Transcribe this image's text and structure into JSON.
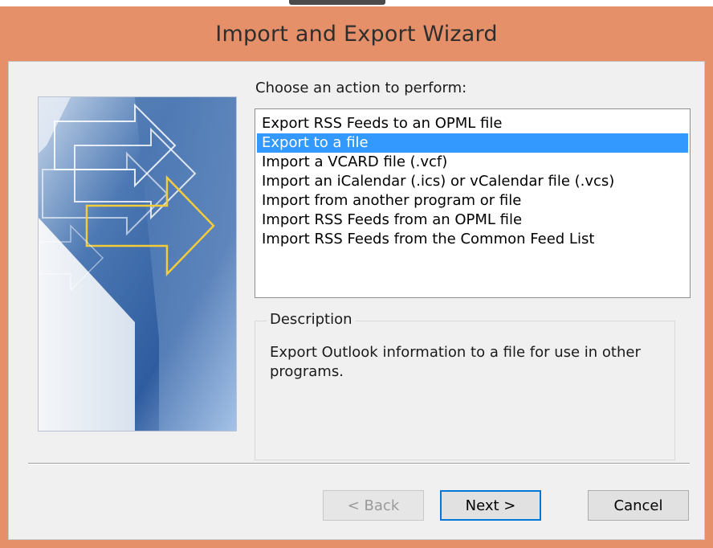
{
  "window": {
    "title": "Import and Export Wizard"
  },
  "main": {
    "prompt": "Choose an action to perform:",
    "actions": [
      {
        "label": "Export RSS Feeds to an OPML file",
        "selected": false
      },
      {
        "label": "Export to a file",
        "selected": true
      },
      {
        "label": "Import a VCARD file (.vcf)",
        "selected": false
      },
      {
        "label": "Import an iCalendar (.ics) or vCalendar file (.vcs)",
        "selected": false
      },
      {
        "label": "Import from another program or file",
        "selected": false
      },
      {
        "label": "Import RSS Feeds from an OPML file",
        "selected": false
      },
      {
        "label": "Import RSS Feeds from the Common Feed List",
        "selected": false
      }
    ],
    "description": {
      "legend": "Description",
      "text": "Export Outlook information to a file for use in other programs."
    }
  },
  "buttons": {
    "back_label": "< Back",
    "next_label": "Next >",
    "cancel_label": "Cancel"
  },
  "colors": {
    "title_bar": "#e6906a",
    "selection": "#3399ff",
    "hero_arrow": "#f2cc3a"
  }
}
